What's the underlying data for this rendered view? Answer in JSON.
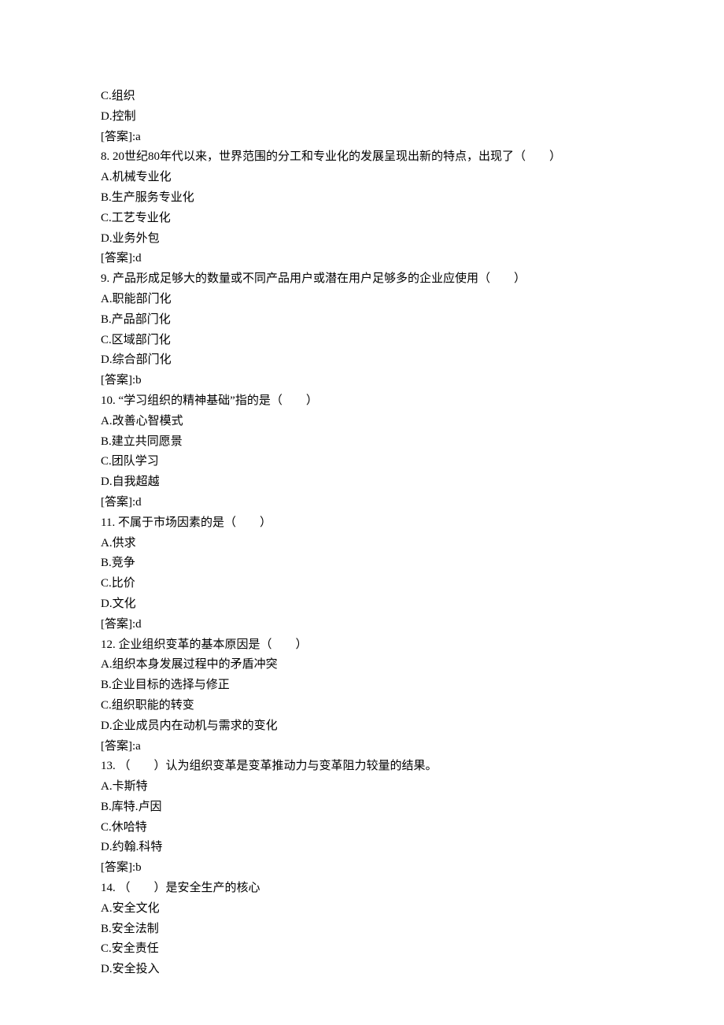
{
  "prelude": {
    "optC": "C.组织",
    "optD": "D.控制",
    "answerLabel": "[答案]:",
    "answer": "a"
  },
  "questions": [
    {
      "num": "8",
      "stem": "20世纪80年代以来，世界范围的分工和专业化的发展呈现出新的特点，出现了（　　）",
      "optA": "A.机械专业化",
      "optB": "B.生产服务专业化",
      "optC": "C.工艺专业化",
      "optD": "D.业务外包",
      "answer": "d"
    },
    {
      "num": "9",
      "stem": "产品形成足够大的数量或不同产品用户或潜在用户足够多的企业应使用（　　）",
      "optA": "A.职能部门化",
      "optB": "B.产品部门化",
      "optC": "C.区域部门化",
      "optD": "D.综合部门化",
      "answer": "b"
    },
    {
      "num": "10",
      "stem": "“学习组织的精神基础”指的是（　　）",
      "optA": "A.改善心智模式",
      "optB": "B.建立共同愿景",
      "optC": "C.团队学习",
      "optD": "D.自我超越",
      "answer": "d"
    },
    {
      "num": "11",
      "stem": "不属于市场因素的是（　　）",
      "optA": "A.供求",
      "optB": "B.竞争",
      "optC": "C.比价",
      "optD": "D.文化",
      "answer": "d"
    },
    {
      "num": "12",
      "stem": "企业组织变革的基本原因是（　　）",
      "optA": "A.组织本身发展过程中的矛盾冲突",
      "optB": "B.企业目标的选择与修正",
      "optC": "C.组织职能的转变",
      "optD": "D.企业成员内在动机与需求的变化",
      "answer": "a"
    },
    {
      "num": "13",
      "stem": "（　　）认为组织变革是变革推动力与变革阻力较量的结果。",
      "optA": "A.卡斯特",
      "optB": "B.库特.卢因",
      "optC": "C.休哈特",
      "optD": "D.约翰.科特",
      "answer": "b"
    },
    {
      "num": "14",
      "stem": "（　　）是安全生产的核心",
      "optA": "A.安全文化",
      "optB": "B.安全法制",
      "optC": "C.安全责任",
      "optD": "D.安全投入",
      "answer": ""
    }
  ],
  "answerLabel": "[答案]:"
}
